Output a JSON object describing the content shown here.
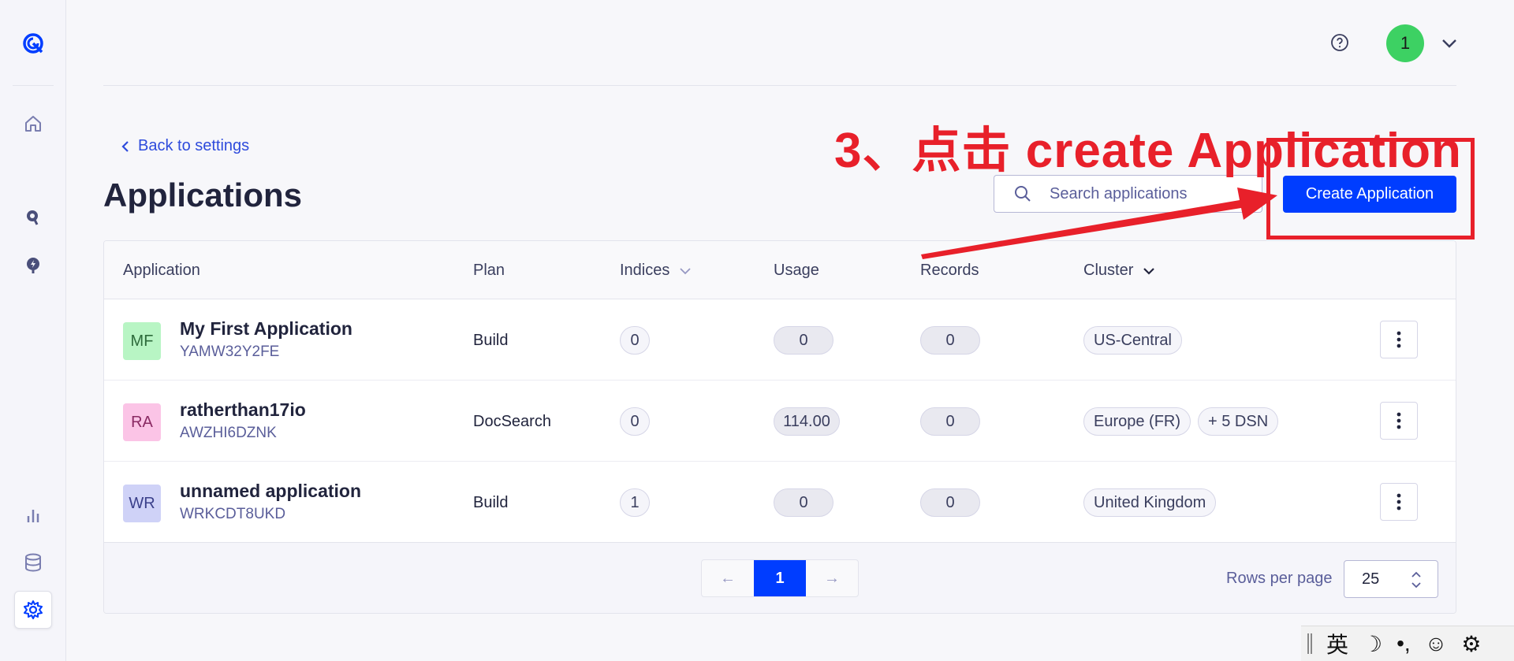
{
  "sidebar": {
    "items": [
      {
        "icon": "algolia-logo-icon"
      },
      {
        "icon": "home-icon"
      },
      {
        "icon": "search-product-icon"
      },
      {
        "icon": "recommend-icon"
      },
      {
        "icon": "analytics-icon"
      },
      {
        "icon": "database-icon"
      },
      {
        "icon": "settings-icon",
        "active": true
      }
    ]
  },
  "header": {
    "avatar_label": "1",
    "avatar_color": "#3dd163"
  },
  "page": {
    "back_label": "Back to settings",
    "title": "Applications",
    "search_placeholder": "Search applications",
    "create_label": "Create Application"
  },
  "annotation": {
    "text": "3、点击 create Application",
    "color": "#e8202a"
  },
  "table": {
    "headers": {
      "application": "Application",
      "plan": "Plan",
      "indices": "Indices",
      "usage": "Usage",
      "records": "Records",
      "cluster": "Cluster"
    },
    "rows": [
      {
        "initials": "MF",
        "avatar_bg": "#b8f5c4",
        "avatar_fg": "#2d6b3b",
        "name": "My First Application",
        "app_id": "YAMW32Y2FE",
        "plan": "Build",
        "indices": "0",
        "usage": "0",
        "records": "0",
        "cluster": "US-Central",
        "cluster_extra": ""
      },
      {
        "initials": "RA",
        "avatar_bg": "#fbc4e6",
        "avatar_fg": "#8a2a63",
        "name": "ratherthan17io",
        "app_id": "AWZHI6DZNK",
        "plan": "DocSearch",
        "indices": "0",
        "usage": "114.00",
        "records": "0",
        "cluster": "Europe (FR)",
        "cluster_extra": "+ 5 DSN"
      },
      {
        "initials": "WR",
        "avatar_bg": "#cfd2f7",
        "avatar_fg": "#3a3f8a",
        "name": "unnamed application",
        "app_id": "WRKCDT8UKD",
        "plan": "Build",
        "indices": "1",
        "usage": "0",
        "records": "0",
        "cluster": "United Kingdom",
        "cluster_extra": ""
      }
    ]
  },
  "pagination": {
    "prev": "←",
    "current": "1",
    "next": "→",
    "rows_per_page_label": "Rows per page",
    "rows_per_page_value": "25"
  },
  "ime_bar": {
    "lang": "英",
    "moon": "☽",
    "punct": "•,",
    "emoji": "☺",
    "gear": "⚙"
  }
}
